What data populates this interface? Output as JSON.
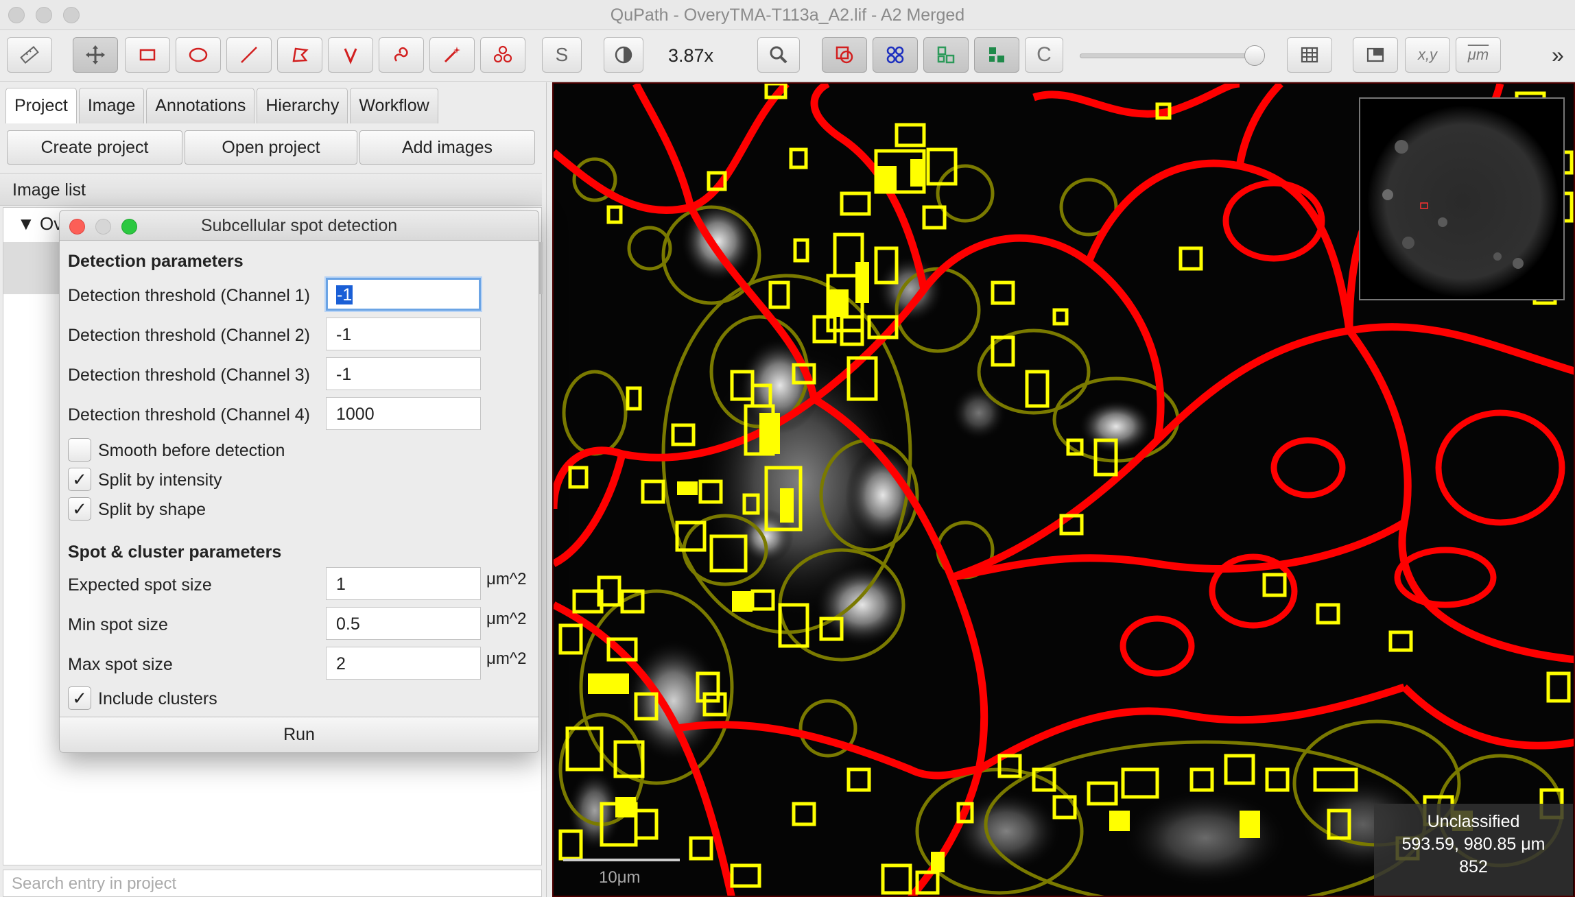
{
  "window": {
    "title": "QuPath - OveryTMA-T113a_A2.lif - A2 Merged"
  },
  "toolbar": {
    "zoom": "3.87x",
    "s_label": "S",
    "c_label": "C",
    "xy_label": "x,y",
    "um_label": "μm",
    "more_label": "»",
    "icons": [
      "ruler-icon",
      "move-icon",
      "rectangle-icon",
      "ellipse-icon",
      "line-icon",
      "polygon-icon",
      "polyline-icon",
      "brush-icon",
      "wand-icon",
      "points-icon",
      "contrast-icon",
      "zoom-to-fit-icon",
      "show-annotations-icon",
      "show-tma-grid-icon",
      "show-detections-icon",
      "fill-detections-icon",
      "table-icon",
      "overview-icon"
    ]
  },
  "tabs": [
    {
      "label": "Project",
      "active": true
    },
    {
      "label": "Image",
      "active": false
    },
    {
      "label": "Annotations",
      "active": false
    },
    {
      "label": "Hierarchy",
      "active": false
    },
    {
      "label": "Workflow",
      "active": false
    }
  ],
  "project_buttons": {
    "create": "Create project",
    "open": "Open project",
    "add": "Add images"
  },
  "image_list": {
    "header": "Image list",
    "entry": "Ov",
    "search_placeholder": "Search entry in project"
  },
  "dialog": {
    "title": "Subcellular spot detection",
    "detection_section": "Detection parameters",
    "thresholds": [
      {
        "label": "Detection threshold (Channel 1)",
        "value": "-1",
        "focused": true
      },
      {
        "label": "Detection threshold (Channel 2)",
        "value": "-1",
        "focused": false
      },
      {
        "label": "Detection threshold (Channel 3)",
        "value": "-1",
        "focused": false
      },
      {
        "label": "Detection threshold (Channel 4)",
        "value": "1000",
        "focused": false
      }
    ],
    "checkboxes": [
      {
        "label": "Smooth before detection",
        "checked": false
      },
      {
        "label": "Split by intensity",
        "checked": true
      },
      {
        "label": "Split by shape",
        "checked": true
      }
    ],
    "spot_section": "Spot & cluster parameters",
    "spot_params": [
      {
        "label": "Expected spot size",
        "value": "1",
        "unit": "μm^2"
      },
      {
        "label": "Min spot size",
        "value": "0.5",
        "unit": "μm^2"
      },
      {
        "label": "Max spot size",
        "value": "2",
        "unit": "μm^2"
      }
    ],
    "include_clusters": {
      "label": "Include clusters",
      "checked": true
    },
    "run_label": "Run"
  },
  "viewer": {
    "classification": "Unclassified",
    "coordinates": "593.59, 980.85 μm",
    "value": "852",
    "scalebar_label": "10μm",
    "colors": {
      "cell_boundary": "#ff0000",
      "cluster_outline": "#7a7a00",
      "spot_outline": "#ffff00",
      "background": "#050505"
    }
  }
}
